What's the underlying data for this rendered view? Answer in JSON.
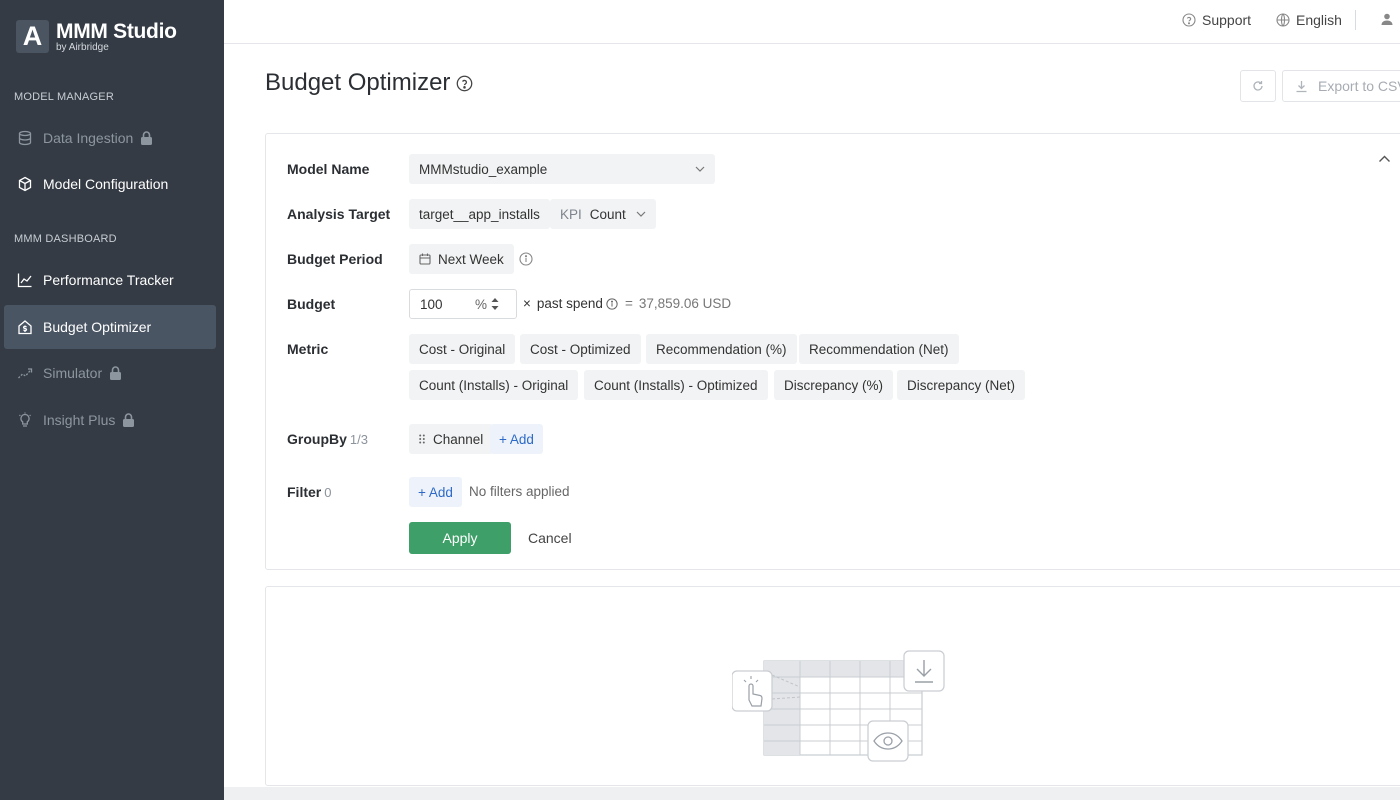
{
  "brand": {
    "logo_letter": "A",
    "title": "MMM Studio",
    "subtitle": "by Airbridge"
  },
  "sidebar": {
    "sections": [
      {
        "label": "MODEL MANAGER"
      },
      {
        "label": "MMM DASHBOARD"
      }
    ],
    "items": [
      {
        "label": "Data Ingestion",
        "icon": "database-icon",
        "locked": true
      },
      {
        "label": "Model Configuration",
        "icon": "cube-icon",
        "locked": false
      },
      {
        "label": "Performance Tracker",
        "icon": "line-chart-icon",
        "locked": false
      },
      {
        "label": "Budget Optimizer",
        "icon": "home-dollar-icon",
        "locked": false,
        "active": true
      },
      {
        "label": "Simulator",
        "icon": "trend-icon",
        "locked": true
      },
      {
        "label": "Insight Plus",
        "icon": "lightbulb-icon",
        "locked": true
      }
    ]
  },
  "topbar": {
    "support": "Support",
    "language": "English"
  },
  "page": {
    "title": "Budget Optimizer",
    "export_label": "Export to CSV"
  },
  "form": {
    "model_name": {
      "label": "Model Name",
      "value": "MMMstudio_example"
    },
    "analysis_target": {
      "label": "Analysis Target",
      "target": "target__app_installs",
      "kpi_prefix": "KPI",
      "kpi_value": "Count"
    },
    "budget_period": {
      "label": "Budget Period",
      "value": "Next Week"
    },
    "budget": {
      "label": "Budget",
      "value": "100",
      "unit": "%",
      "times": "×",
      "past_spend": "past spend",
      "equals": "=",
      "result": "37,859.06 USD"
    },
    "metric": {
      "label": "Metric",
      "options": [
        "Cost - Original",
        "Cost - Optimized",
        "Recommendation (%)",
        "Recommendation (Net)",
        "Count (Installs) - Original",
        "Count (Installs) - Optimized",
        "Discrepancy (%)",
        "Discrepancy (Net)"
      ]
    },
    "groupby": {
      "label": "GroupBy",
      "count": "1/3",
      "item": "Channel",
      "add": "+ Add"
    },
    "filter": {
      "label": "Filter",
      "count": "0",
      "add": "+ Add",
      "empty": "No filters applied"
    },
    "apply": "Apply",
    "cancel": "Cancel"
  },
  "colors": {
    "sidebar_bg": "#343b44",
    "accent_green": "#3f9f68",
    "link_blue": "#2d6ac8"
  }
}
